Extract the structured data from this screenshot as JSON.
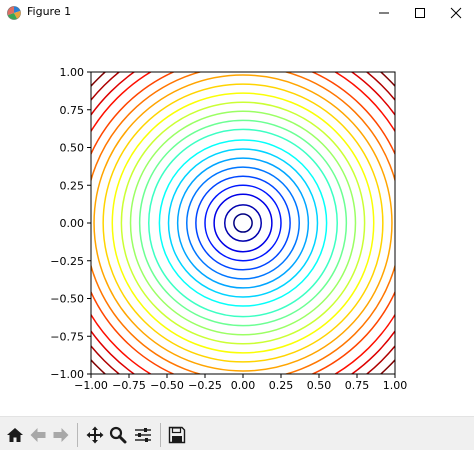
{
  "window": {
    "title": "Figure 1",
    "icons": {
      "app": "matplotlib-figure-icon",
      "minimize": "minimize-icon",
      "maximize": "maximize-icon",
      "close": "close-icon"
    }
  },
  "toolbar": {
    "buttons": [
      {
        "name": "home-button",
        "icon": "home-icon"
      },
      {
        "name": "back-button",
        "icon": "arrow-left-icon"
      },
      {
        "name": "forward-button",
        "icon": "arrow-right-icon"
      },
      {
        "name": "pan-button",
        "icon": "move-icon"
      },
      {
        "name": "zoom-button",
        "icon": "magnifier-icon"
      },
      {
        "name": "configure-subplots-button",
        "icon": "sliders-icon"
      },
      {
        "name": "save-button",
        "icon": "floppy-disk-icon"
      }
    ]
  },
  "chart_data": {
    "type": "contour",
    "function": "sqrt(x^2 + y^2)",
    "colormap": "jet",
    "xlim": [
      -1.0,
      1.0
    ],
    "ylim": [
      -1.0,
      1.0
    ],
    "xticks": [
      "−1.00",
      "−0.75",
      "−0.50",
      "−0.25",
      "0.00",
      "0.25",
      "0.50",
      "0.75",
      "1.00"
    ],
    "yticks": [
      "1.00",
      "0.75",
      "0.50",
      "0.25",
      "0.00",
      "−0.25",
      "−0.50",
      "−0.75",
      "−1.00"
    ],
    "levels": [
      0.06,
      0.12,
      0.19,
      0.25,
      0.31,
      0.37,
      0.43,
      0.49,
      0.55,
      0.62,
      0.68,
      0.74,
      0.8,
      0.86,
      0.92,
      0.98,
      1.04,
      1.1,
      1.17,
      1.23,
      1.29,
      1.35
    ],
    "title": "",
    "xlabel": "",
    "ylabel": "",
    "grid": false,
    "legend": "none"
  }
}
